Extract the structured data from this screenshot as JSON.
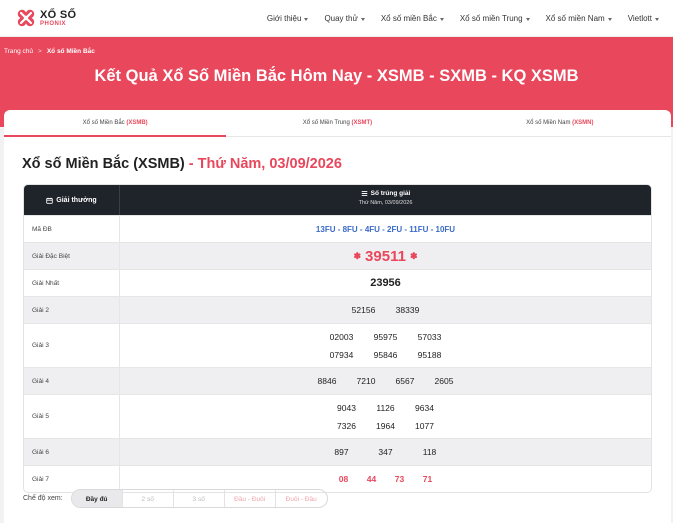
{
  "brand": {
    "line1": "XỔ SỐ",
    "line2": "PHONIX",
    "accent": "#e8475c",
    "logo_icon": "x-circle-logo-icon"
  },
  "nav": {
    "items": [
      {
        "label": "Giới thiệu",
        "dropdown": true
      },
      {
        "label": "Quay thử",
        "dropdown": true
      },
      {
        "label": "Xổ số miền Bắc",
        "dropdown": true
      },
      {
        "label": "Xổ số miền Trung",
        "dropdown": true
      },
      {
        "label": "Xổ số miền Nam",
        "dropdown": true
      },
      {
        "label": "Vietlott",
        "dropdown": true
      }
    ]
  },
  "breadcrumb": {
    "home": "Trang chủ",
    "sep": ">",
    "current": "Xổ số Miền Bắc"
  },
  "hero": {
    "title": "Kết Quả Xổ Số Miền Bắc Hôm Nay - XSMB - SXMB - KQ XSMB"
  },
  "tabs": [
    {
      "label": "Xổ số Miền Bắc ",
      "code": "(XSMB)",
      "active": true
    },
    {
      "label": "Xổ số Miền Trung ",
      "code": "(XSMT)",
      "active": false
    },
    {
      "label": "Xổ số Miền Nam ",
      "code": "(XSMN)",
      "active": false
    }
  ],
  "section": {
    "title": "Xổ số Miền Bắc (XSMB)",
    "dash": " - ",
    "date": "Thứ Năm, 03/09/2026"
  },
  "table": {
    "col_prize": "Giải thưởng",
    "col_numbers": "Số trúng giải",
    "col_date": "Thứ Năm, 03/09/2026",
    "rows": {
      "ma_db": {
        "label": "Mã ĐB",
        "value": "13FU - 8FU - 4FU - 2FU - 11FU - 10FU"
      },
      "dac_biet": {
        "label": "Giải Đặc Biệt",
        "value": "39511"
      },
      "nhat": {
        "label": "Giải Nhất",
        "value": "23956"
      },
      "nhi": {
        "label": "Giải 2",
        "values": [
          "52156",
          "38339"
        ]
      },
      "ba": {
        "label": "Giải 3",
        "values": [
          "02003",
          "95975",
          "57033",
          "07934",
          "95846",
          "95188"
        ]
      },
      "tu": {
        "label": "Giải 4",
        "values": [
          "8846",
          "7210",
          "6567",
          "2605"
        ]
      },
      "nam": {
        "label": "Giải 5",
        "values": [
          "9043",
          "1126",
          "9634",
          "7326",
          "1964",
          "1077"
        ]
      },
      "sau": {
        "label": "Giải 6",
        "values": [
          "897",
          "347",
          "118"
        ]
      },
      "bay": {
        "label": "Giải 7",
        "values": [
          "08",
          "44",
          "73",
          "71"
        ]
      }
    }
  },
  "display_mode": {
    "label": "Chế độ xem:",
    "options": [
      "Đầy đủ",
      "2 số",
      "3 số",
      "Đầu - Đuôi",
      "Đuôi - Đầu"
    ],
    "selected": "Đầy đủ"
  }
}
